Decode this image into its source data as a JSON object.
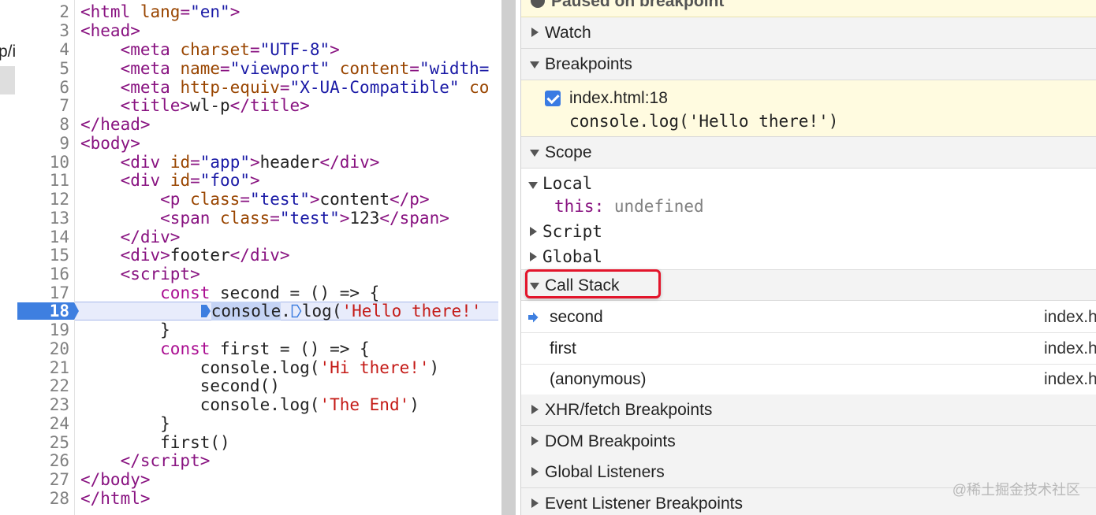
{
  "left_strip": {
    "fragment": "p/i"
  },
  "editor": {
    "lines": [
      {
        "n": "2"
      },
      {
        "n": "3"
      },
      {
        "n": "4"
      },
      {
        "n": "5"
      },
      {
        "n": "6"
      },
      {
        "n": "7"
      },
      {
        "n": "8"
      },
      {
        "n": "9"
      },
      {
        "n": "10"
      },
      {
        "n": "11"
      },
      {
        "n": "12"
      },
      {
        "n": "13"
      },
      {
        "n": "14"
      },
      {
        "n": "15"
      },
      {
        "n": "16"
      },
      {
        "n": "17"
      },
      {
        "n": "18"
      },
      {
        "n": "19"
      },
      {
        "n": "20"
      },
      {
        "n": "21"
      },
      {
        "n": "22"
      },
      {
        "n": "23"
      },
      {
        "n": "24"
      },
      {
        "n": "25"
      },
      {
        "n": "26"
      },
      {
        "n": "27"
      },
      {
        "n": "28"
      }
    ],
    "execution_line": "18"
  },
  "panel": {
    "paused_banner": "Paused on breakpoint",
    "watch": "Watch",
    "breakpoints": "Breakpoints",
    "breakpoint_item": {
      "file": "index.html:18",
      "snippet": "console.log('Hello there!')",
      "checked": true
    },
    "scope": "Scope",
    "scope_local": "Local",
    "scope_this_key": "this:",
    "scope_this_value": "undefined",
    "scope_script": "Script",
    "scope_global": "Global",
    "call_stack": "Call Stack",
    "frames": [
      {
        "name": "second",
        "location": "index.h",
        "current": true
      },
      {
        "name": "first",
        "location": "index.h",
        "current": false
      },
      {
        "name": "(anonymous)",
        "location": "index.h",
        "current": false
      }
    ],
    "xhr_breakpoints": "XHR/fetch Breakpoints",
    "dom_breakpoints": "DOM Breakpoints",
    "global_listeners": "Global Listeners",
    "event_listener_breakpoints": "Event Listener Breakpoints"
  },
  "watermark": "@稀土掘金技术社区",
  "colors": {
    "accent": "#3e7fe0",
    "highlight_box": "#e3152b",
    "paused_bg": "#fffbe0"
  }
}
